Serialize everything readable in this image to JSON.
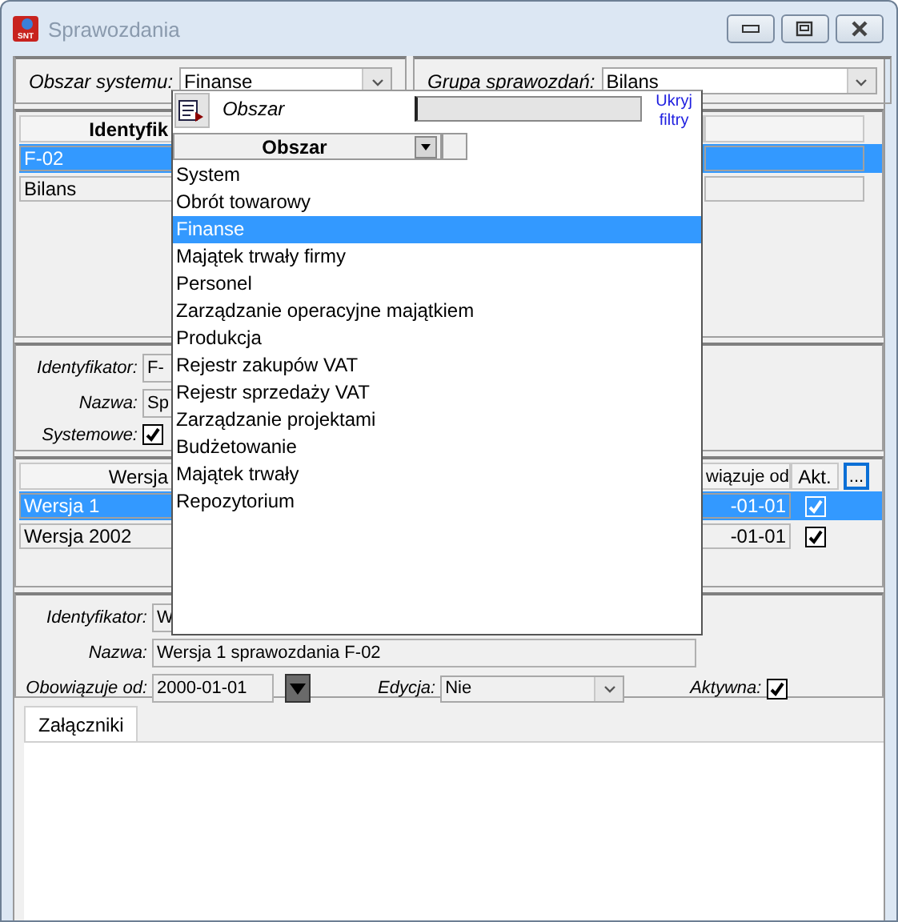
{
  "window": {
    "title": "Sprawozdania",
    "logo": "SNT"
  },
  "filters": [
    {
      "label": "Obszar systemu:",
      "value": "Finanse"
    },
    {
      "label": "Grupa sprawozdań:",
      "value": "Bilans"
    }
  ],
  "reports_table": {
    "columns": [
      "Identyfik"
    ],
    "rows": [
      {
        "cells": [
          "F-02"
        ],
        "selected": true
      },
      {
        "cells": [
          "Bilans"
        ],
        "selected": false
      }
    ]
  },
  "report_details": {
    "fields": [
      {
        "label": "Identyfikator:",
        "value": "F-"
      },
      {
        "label": "Nazwa:",
        "value": "Sp"
      }
    ],
    "system": {
      "label": "Systemowe:",
      "checked": true
    }
  },
  "versions_table": {
    "columns": [
      "Wersja",
      "wiązuje od",
      "Akt."
    ],
    "more_button": "...",
    "rows": [
      {
        "name": "Wersja 1",
        "date": "-01-01",
        "active": true,
        "selected": true
      },
      {
        "name": "Wersja 2002",
        "date": "-01-01",
        "active": true,
        "selected": false
      }
    ]
  },
  "version_details": {
    "fields": [
      {
        "label": "Identyfikator:",
        "value": "W"
      },
      {
        "label": "Nazwa:",
        "value": "Wersja 1 sprawozdania F-02"
      }
    ],
    "valid_from": {
      "label": "Obowiązuje od:",
      "value": "2000-01-01"
    },
    "edition": {
      "label": "Edycja:",
      "value": "Nie"
    },
    "active": {
      "label": "Aktywna:",
      "checked": true
    }
  },
  "tabs": [
    {
      "label": "Załączniki",
      "selected": true
    }
  ],
  "dropdown": {
    "title": "Obszar",
    "hide_filters_link": "Ukryj filtry",
    "column": "Obszar",
    "items": [
      {
        "label": "System",
        "selected": false
      },
      {
        "label": "Obrót towarowy",
        "selected": false
      },
      {
        "label": "Finanse",
        "selected": true
      },
      {
        "label": "Majątek trwały firmy",
        "selected": false
      },
      {
        "label": "Personel",
        "selected": false
      },
      {
        "label": "Zarządzanie operacyjne majątkiem",
        "selected": false
      },
      {
        "label": "Produkcja",
        "selected": false
      },
      {
        "label": "Rejestr zakupów VAT",
        "selected": false
      },
      {
        "label": "Rejestr sprzedaży VAT",
        "selected": false
      },
      {
        "label": "Zarządzanie projektami",
        "selected": false
      },
      {
        "label": "Budżetowanie",
        "selected": false
      },
      {
        "label": "Majątek trwały",
        "selected": false
      },
      {
        "label": "Repozytorium",
        "selected": false
      }
    ]
  }
}
